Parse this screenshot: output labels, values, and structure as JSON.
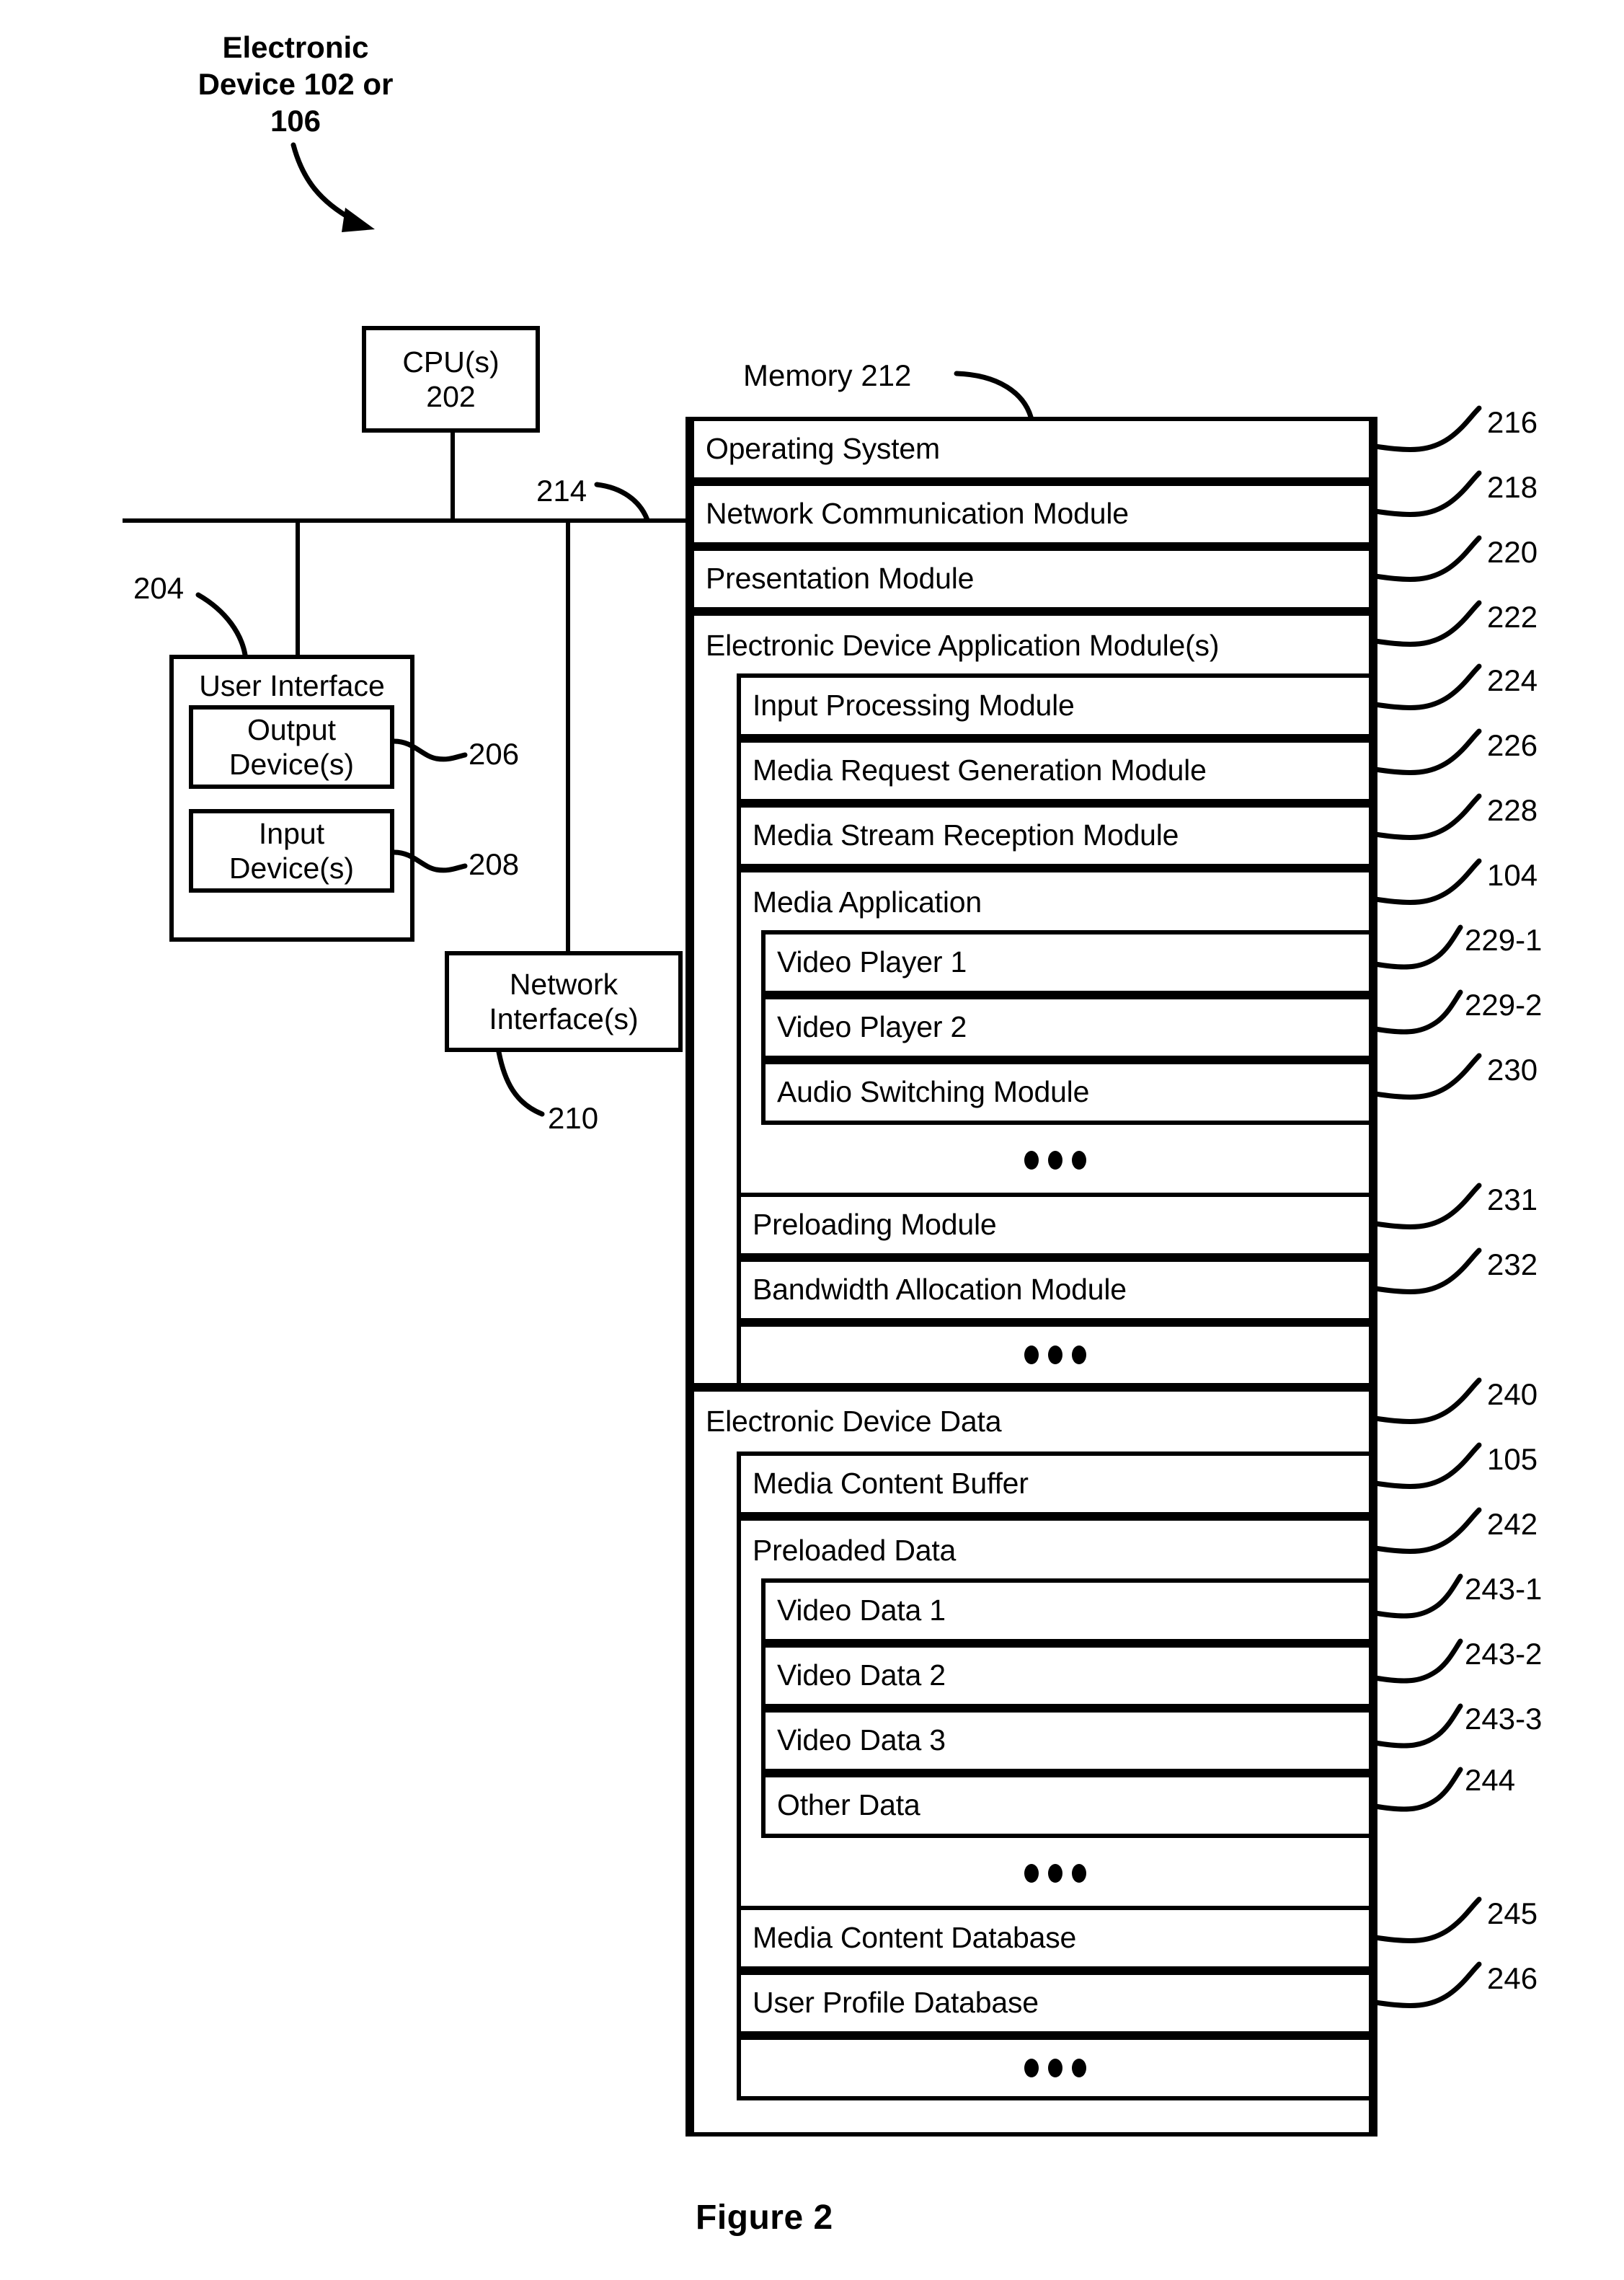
{
  "figure": {
    "caption": "Figure 2",
    "title": "Electronic\nDevice 102 or\n106"
  },
  "hardware": {
    "cpu": {
      "label": "CPU(s)\n202"
    },
    "bus_ref": "214",
    "user_interface": {
      "label": "User Interface",
      "ref": "204",
      "output_devices": {
        "label": "Output\nDevice(s)",
        "ref": "206"
      },
      "input_devices": {
        "label": "Input\nDevice(s)",
        "ref": "208"
      }
    },
    "network_interface": {
      "label": "Network\nInterface(s)",
      "ref": "210"
    }
  },
  "memory": {
    "label": "Memory 212",
    "rows": [
      {
        "label": "Operating System",
        "ref": "216"
      },
      {
        "label": "Network Communication Module",
        "ref": "218"
      },
      {
        "label": "Presentation Module",
        "ref": "220"
      },
      {
        "label": "Electronic Device Application Module(s)",
        "ref": "222"
      },
      {
        "label": "Input Processing Module",
        "ref": "224"
      },
      {
        "label": "Media Request Generation Module",
        "ref": "226"
      },
      {
        "label": "Media Stream Reception Module",
        "ref": "228"
      },
      {
        "label": "Media Application",
        "ref": "104"
      },
      {
        "label": "Video Player 1",
        "ref": "229-1"
      },
      {
        "label": "Video Player 2",
        "ref": "229-2"
      },
      {
        "label": "Audio Switching Module",
        "ref": "230"
      },
      {
        "label": "Preloading Module",
        "ref": "231"
      },
      {
        "label": "Bandwidth Allocation Module",
        "ref": "232"
      },
      {
        "label": "Electronic Device Data",
        "ref": "240"
      },
      {
        "label": "Media Content Buffer",
        "ref": "105"
      },
      {
        "label": "Preloaded Data",
        "ref": "242"
      },
      {
        "label": "Video Data 1",
        "ref": "243-1"
      },
      {
        "label": "Video Data 2",
        "ref": "243-2"
      },
      {
        "label": "Video Data 3",
        "ref": "243-3"
      },
      {
        "label": "Other Data",
        "ref": "244"
      },
      {
        "label": "Media Content Database",
        "ref": "245"
      },
      {
        "label": "User Profile Database",
        "ref": "246"
      }
    ]
  }
}
